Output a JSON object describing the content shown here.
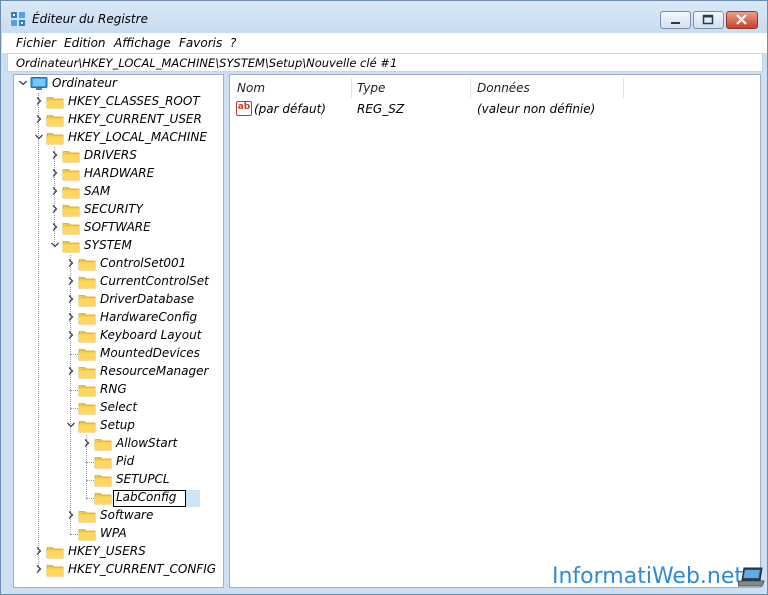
{
  "window": {
    "title": "Éditeur du Registre"
  },
  "menu": [
    "Fichier",
    "Edition",
    "Affichage",
    "Favoris",
    "?"
  ],
  "address": "Ordinateur\\HKEY_LOCAL_MACHINE\\SYSTEM\\Setup\\Nouvelle clé #1",
  "tree": [
    {
      "label": "Ordinateur",
      "level": 0,
      "state": "expanded",
      "icon": "computer-icon"
    },
    {
      "label": "HKEY_CLASSES_ROOT",
      "level": 1,
      "state": "collapsed",
      "icon": "folder-icon"
    },
    {
      "label": "HKEY_CURRENT_USER",
      "level": 1,
      "state": "collapsed",
      "icon": "folder-icon"
    },
    {
      "label": "HKEY_LOCAL_MACHINE",
      "level": 1,
      "state": "expanded",
      "icon": "folder-icon"
    },
    {
      "label": "DRIVERS",
      "level": 2,
      "state": "collapsed",
      "icon": "folder-icon"
    },
    {
      "label": "HARDWARE",
      "level": 2,
      "state": "collapsed",
      "icon": "folder-icon"
    },
    {
      "label": "SAM",
      "level": 2,
      "state": "collapsed",
      "icon": "folder-icon"
    },
    {
      "label": "SECURITY",
      "level": 2,
      "state": "collapsed",
      "icon": "folder-icon"
    },
    {
      "label": "SOFTWARE",
      "level": 2,
      "state": "collapsed",
      "icon": "folder-icon"
    },
    {
      "label": "SYSTEM",
      "level": 2,
      "state": "expanded",
      "icon": "folder-icon"
    },
    {
      "label": "ControlSet001",
      "level": 3,
      "state": "collapsed",
      "icon": "folder-icon"
    },
    {
      "label": "CurrentControlSet",
      "level": 3,
      "state": "collapsed",
      "icon": "folder-icon"
    },
    {
      "label": "DriverDatabase",
      "level": 3,
      "state": "collapsed",
      "icon": "folder-icon"
    },
    {
      "label": "HardwareConfig",
      "level": 3,
      "state": "collapsed",
      "icon": "folder-icon"
    },
    {
      "label": "Keyboard Layout",
      "level": 3,
      "state": "collapsed",
      "icon": "folder-icon"
    },
    {
      "label": "MountedDevices",
      "level": 3,
      "state": "leaf",
      "icon": "folder-icon"
    },
    {
      "label": "ResourceManager",
      "level": 3,
      "state": "collapsed",
      "icon": "folder-icon"
    },
    {
      "label": "RNG",
      "level": 3,
      "state": "leaf",
      "icon": "folder-icon"
    },
    {
      "label": "Select",
      "level": 3,
      "state": "leaf",
      "icon": "folder-icon"
    },
    {
      "label": "Setup",
      "level": 3,
      "state": "expanded",
      "icon": "folder-icon"
    },
    {
      "label": "AllowStart",
      "level": 4,
      "state": "collapsed",
      "icon": "folder-icon"
    },
    {
      "label": "Pid",
      "level": 4,
      "state": "leaf",
      "icon": "folder-icon"
    },
    {
      "label": "SETUPCL",
      "level": 4,
      "state": "leaf",
      "icon": "folder-icon"
    },
    {
      "label": "LabConfig",
      "level": 4,
      "state": "editing",
      "icon": "folder-icon"
    },
    {
      "label": "Software",
      "level": 3,
      "state": "collapsed",
      "icon": "folder-icon"
    },
    {
      "label": "WPA",
      "level": 3,
      "state": "leaf",
      "icon": "folder-icon"
    },
    {
      "label": "HKEY_USERS",
      "level": 1,
      "state": "collapsed",
      "icon": "folder-icon"
    },
    {
      "label": "HKEY_CURRENT_CONFIG",
      "level": 1,
      "state": "collapsed",
      "icon": "folder-icon"
    }
  ],
  "list": {
    "columns": [
      "Nom",
      "Type",
      "Données"
    ],
    "rows": [
      {
        "name": "(par défaut)",
        "type": "REG_SZ",
        "data": "(valeur non définie)",
        "icon": "string-value-icon",
        "icon_text": "ab"
      }
    ]
  },
  "watermark": "InformatiWeb.net"
}
